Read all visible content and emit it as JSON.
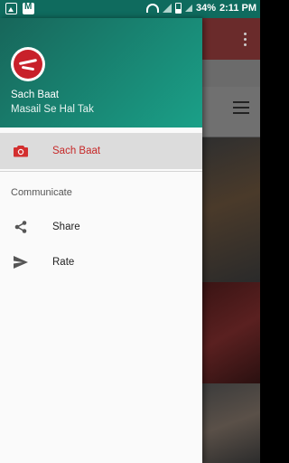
{
  "status_bar": {
    "battery": "34%",
    "time": "2:11 PM"
  },
  "drawer": {
    "app_name": "Sach Baat",
    "tagline": "Masail Se Hal Tak",
    "items": [
      {
        "label": "Sach Baat",
        "icon": "camera-icon",
        "selected": true
      }
    ],
    "section_title": "Communicate",
    "communicate_items": [
      {
        "label": "Share",
        "icon": "share-icon"
      },
      {
        "label": "Rate",
        "icon": "send-icon"
      }
    ]
  },
  "colors": {
    "header_start": "#17665a",
    "header_end": "#1aa088",
    "accent": "#c62828",
    "selected_bg": "#dcdcdc"
  }
}
